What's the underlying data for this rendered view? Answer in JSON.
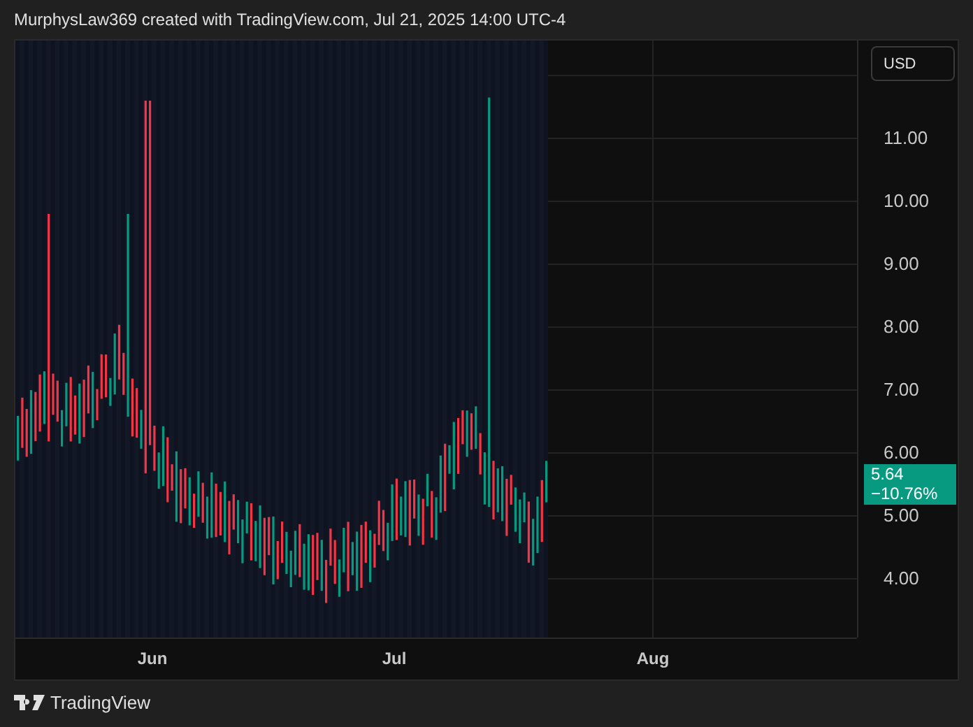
{
  "header": {
    "caption": "MurphysLaw369 created with TradingView.com, Jul 21, 2025 14:00 UTC-4"
  },
  "currency_button": {
    "label": "USD"
  },
  "price_axis": {
    "labels": [
      "11.00",
      "10.00",
      "9.00",
      "8.00",
      "7.00",
      "6.00",
      "5.00",
      "4.00"
    ]
  },
  "last_price": {
    "price": "5.64",
    "change": "−10.76%"
  },
  "time_axis": {
    "labels": [
      "Jun",
      "Jul",
      "Aug"
    ]
  },
  "footer": {
    "brand": "TradingView"
  }
}
